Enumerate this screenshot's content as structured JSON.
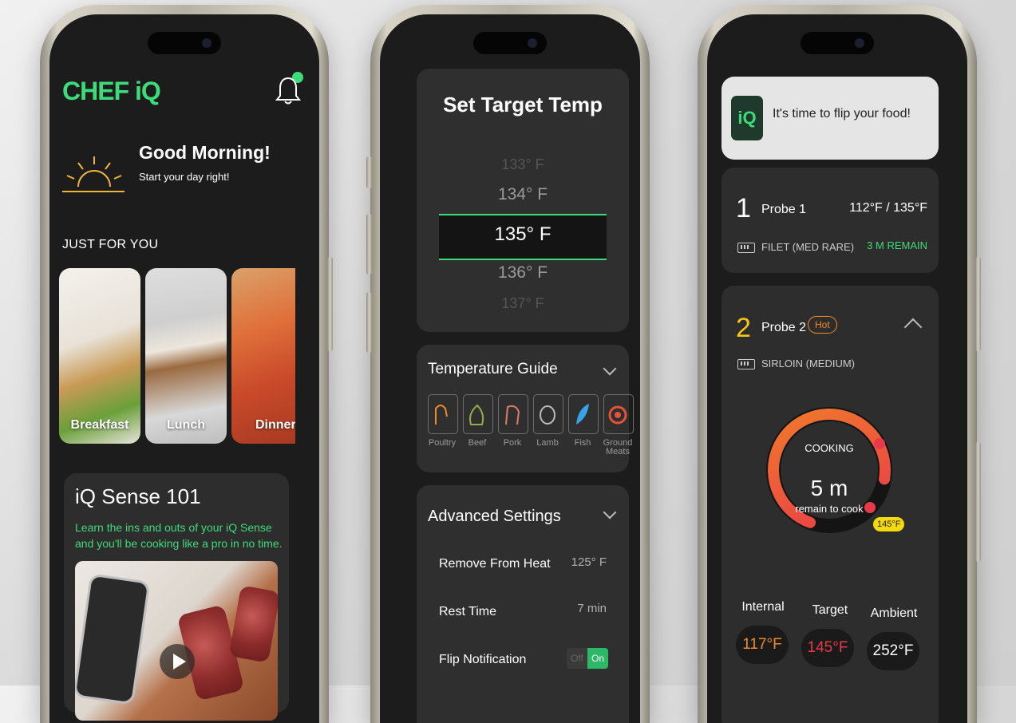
{
  "phone1": {
    "logo": "CHEF iQ",
    "greeting_title": "Good Morning!",
    "greeting_sub": "Start your day right!",
    "section_title": "JUST FOR YOU",
    "cards": [
      {
        "label": "Breakfast"
      },
      {
        "label": "Lunch"
      },
      {
        "label": "Dinner"
      }
    ],
    "sense": {
      "title": "iQ Sense 101",
      "body": "Learn the ins and outs of your iQ Sense and you'll be cooking like a pro in no time."
    }
  },
  "phone2": {
    "title": "Set Target Temp",
    "wheel": [
      "133° F",
      "134° F",
      "135° F",
      "136° F",
      "137° F"
    ],
    "guide": {
      "title": "Temperature Guide",
      "items": [
        {
          "label": "Poultry",
          "icon": "poultry-icon",
          "color": "#f08a2a"
        },
        {
          "label": "Beef",
          "icon": "beef-icon",
          "color": "#8fae4a"
        },
        {
          "label": "Pork",
          "icon": "pork-icon",
          "color": "#e07a6a"
        },
        {
          "label": "Lamb",
          "icon": "lamb-icon",
          "color": "#bbbbbb"
        },
        {
          "label": "Fish",
          "icon": "fish-icon",
          "color": "#3aa2e8"
        },
        {
          "label": "Ground Meats",
          "icon": "ground-meat-icon",
          "color": "#e0553a"
        }
      ]
    },
    "advanced": {
      "title": "Advanced Settings",
      "rows": [
        {
          "label": "Remove From Heat",
          "value": "125° F"
        },
        {
          "label": "Rest Time",
          "value": "7 min"
        },
        {
          "label": "Flip Notification",
          "off": "Off",
          "on": "On"
        }
      ]
    }
  },
  "phone3": {
    "notification": {
      "icon": "iQ",
      "text": "It's time to flip your food!"
    },
    "probe1": {
      "num": "1",
      "name": "Probe 1",
      "temps": "112°F / 135°F",
      "food": "FILET (MED RARE)",
      "remain": "3 M REMAIN"
    },
    "probe2": {
      "num": "2",
      "name": "Probe 2",
      "badge": "Hot",
      "food": "SIRLOIN (MEDIUM)"
    },
    "gauge": {
      "status": "COOKING",
      "time": "5 m",
      "sub": "remain to cook",
      "marker": "145°F",
      "progress": 0.72
    },
    "metrics": [
      {
        "label": "Internal",
        "value": "117°F",
        "color": "#f08a2a"
      },
      {
        "label": "Target",
        "value": "145°F",
        "color": "#e8394a"
      },
      {
        "label": "Ambient",
        "value": "252°F",
        "color": "#ffffff"
      }
    ],
    "colors": {
      "accent": "#3ddc7b",
      "probe1_num": "#ffffff",
      "probe2_num": "#f5c518"
    }
  }
}
